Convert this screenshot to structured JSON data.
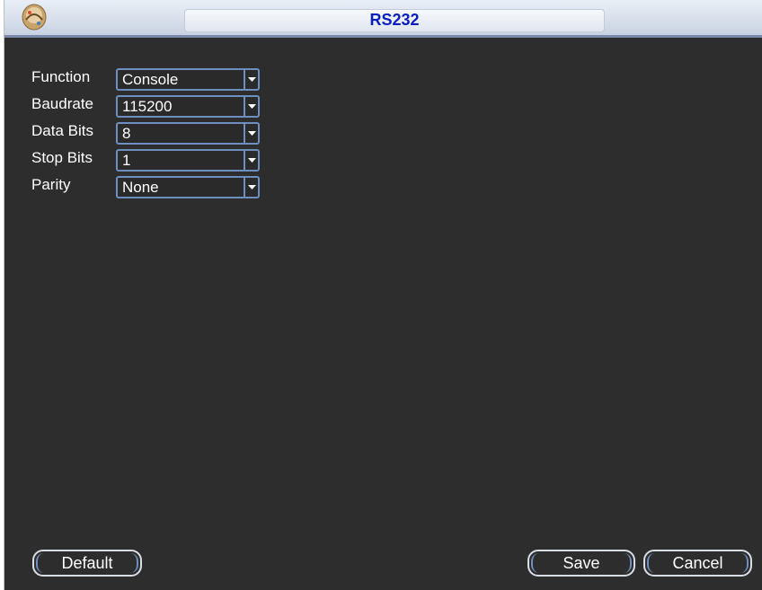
{
  "window": {
    "title": "RS232",
    "logo_icon": "network-device-icon"
  },
  "form": {
    "fields": [
      {
        "label": "Function",
        "value": "Console"
      },
      {
        "label": "Baudrate",
        "value": "115200"
      },
      {
        "label": "Data Bits",
        "value": "8"
      },
      {
        "label": "Stop Bits",
        "value": "1"
      },
      {
        "label": "Parity",
        "value": "None"
      }
    ]
  },
  "buttons": {
    "default_label": "Default",
    "save_label": "Save",
    "cancel_label": "Cancel"
  },
  "colors": {
    "background": "#2d2d2d",
    "title_text": "#0a1ebf",
    "control_border": "#6d8fc0"
  }
}
